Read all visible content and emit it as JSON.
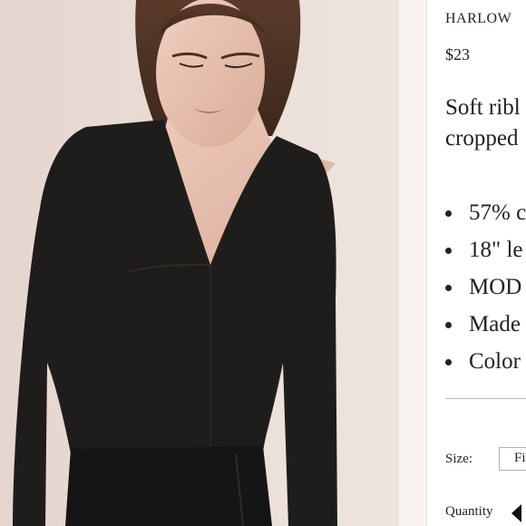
{
  "product": {
    "title": "HARLOW",
    "price": "$23",
    "description_lines": [
      "Soft ribl",
      "cropped"
    ],
    "features": [
      "57% c",
      "18\" le",
      "MOD",
      "Made",
      "Color"
    ]
  },
  "options": {
    "size_label": "Size:",
    "size_value": "Fi",
    "quantity_label": "Quantity"
  },
  "icons": {
    "quantity_decrement": "triangle-left-icon"
  },
  "colors": {
    "background": "#ffffff",
    "photo_backdrop": "#e9dcd6",
    "top_fabric": "#1f1d1b",
    "rule": "#c9b8aa"
  }
}
